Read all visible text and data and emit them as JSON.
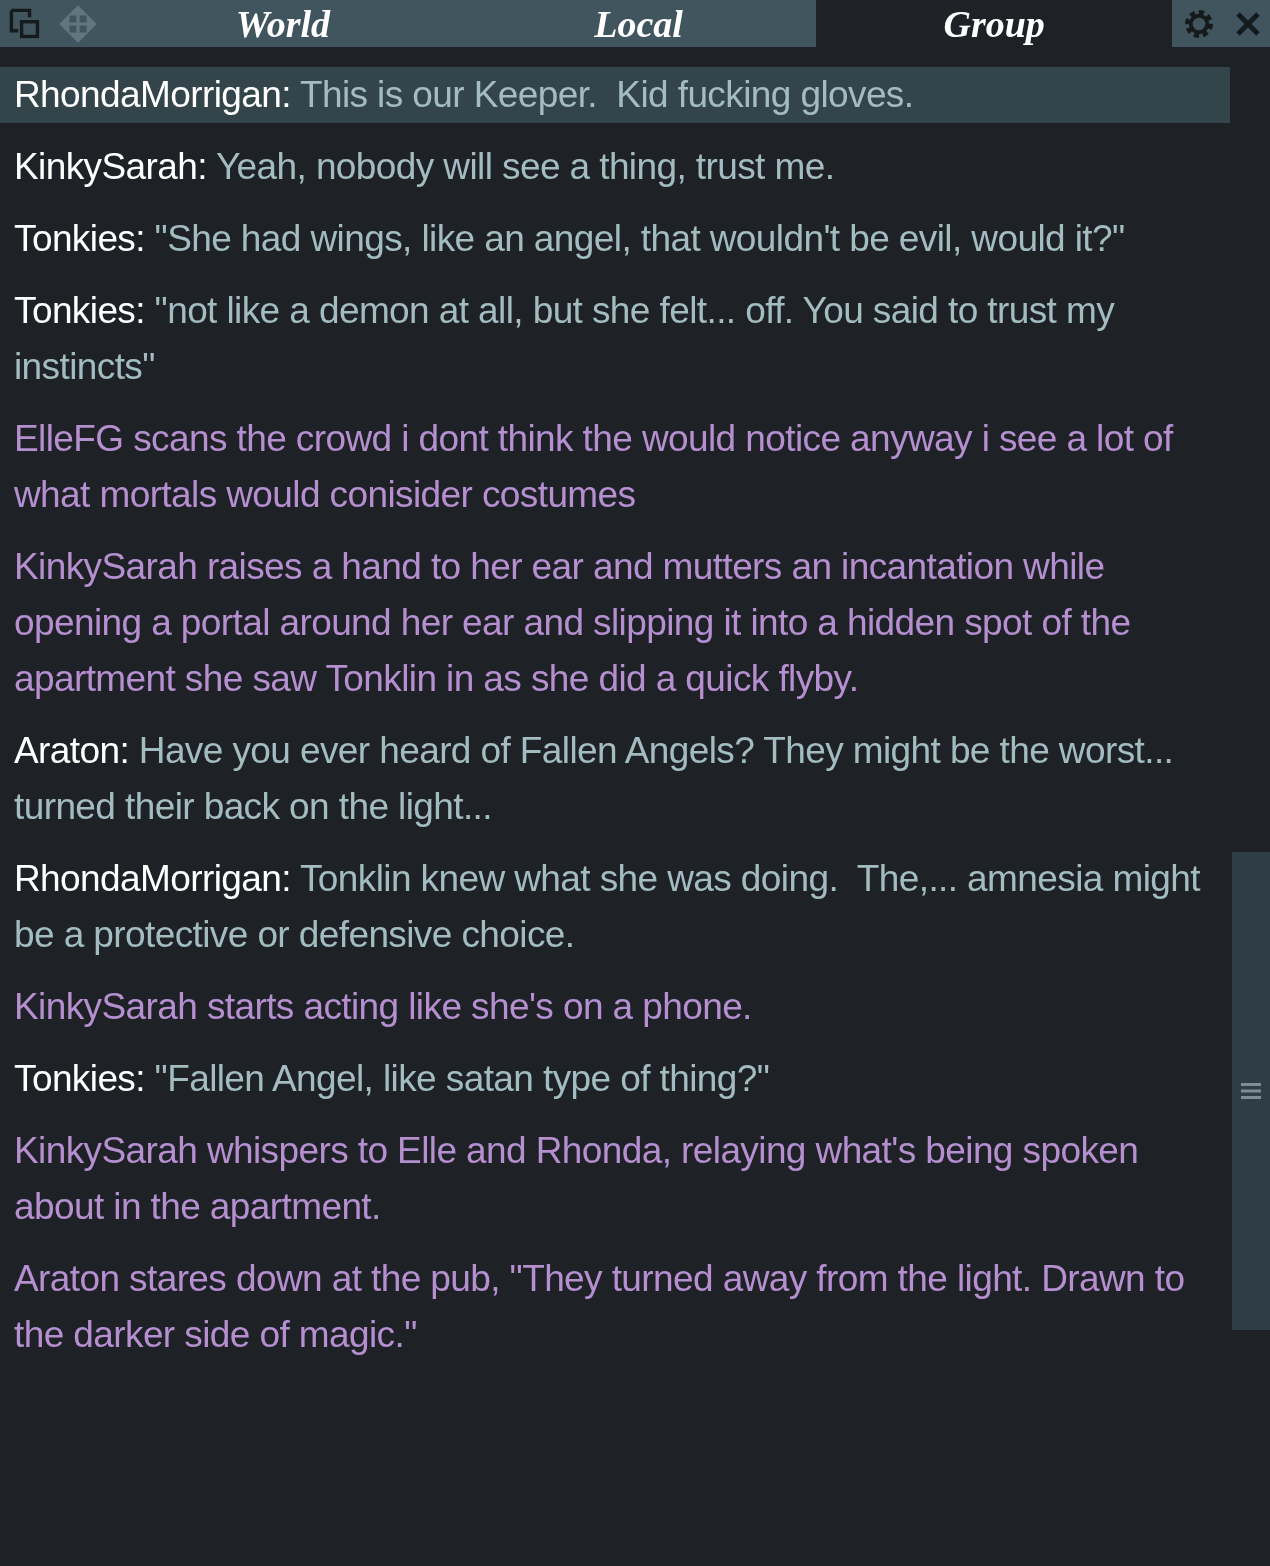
{
  "tabs": [
    {
      "label": "World",
      "selected": false
    },
    {
      "label": "Local",
      "selected": false
    },
    {
      "label": "Group",
      "selected": true
    }
  ],
  "messages": [
    {
      "kind": "say",
      "name": "RhondaMorrigan:",
      "text": "This is our Keeper.  Kid fucking gloves.",
      "selected": true
    },
    {
      "kind": "say",
      "name": "KinkySarah:",
      "text": "Yeah, nobody will see a thing, trust me.",
      "selected": false
    },
    {
      "kind": "say",
      "name": "Tonkies:",
      "text": "\"She had wings, like an angel, that wouldn't be evil, would it?\"",
      "selected": false
    },
    {
      "kind": "say",
      "name": "Tonkies:",
      "text": "\"not like a demon at all, but she felt... off. You said to trust my instincts\"",
      "selected": false
    },
    {
      "kind": "emote",
      "text": "ElleFG scans the crowd i dont think the would notice anyway i see a lot of what mortals would conisider costumes",
      "selected": false
    },
    {
      "kind": "emote",
      "text": "KinkySarah raises a hand to her ear and mutters an incantation while opening a portal around her ear and slipping it into a hidden spot of the apartment she saw Tonklin in as she did a quick flyby.",
      "selected": false
    },
    {
      "kind": "say",
      "name": "Araton:",
      "text": "Have you ever heard of Fallen Angels? They might be the worst... turned their back on the light...",
      "selected": false
    },
    {
      "kind": "say",
      "name": "RhondaMorrigan:",
      "text": "Tonklin knew what she was doing.  The,... amnesia might be a protective or defensive choice.",
      "selected": false
    },
    {
      "kind": "emote",
      "text": "KinkySarah starts acting like she's on a phone.",
      "selected": false
    },
    {
      "kind": "say",
      "name": "Tonkies:",
      "text": "\"Fallen Angel, like satan type of thing?\"",
      "selected": false
    },
    {
      "kind": "emote",
      "text": "KinkySarah whispers to Elle and Rhonda, relaying what's being spoken about in the apartment.",
      "selected": false
    },
    {
      "kind": "emote",
      "text": "Araton stares down at the pub, \"They turned away from the light. Drawn to the darker side of magic.\"",
      "selected": false
    }
  ]
}
